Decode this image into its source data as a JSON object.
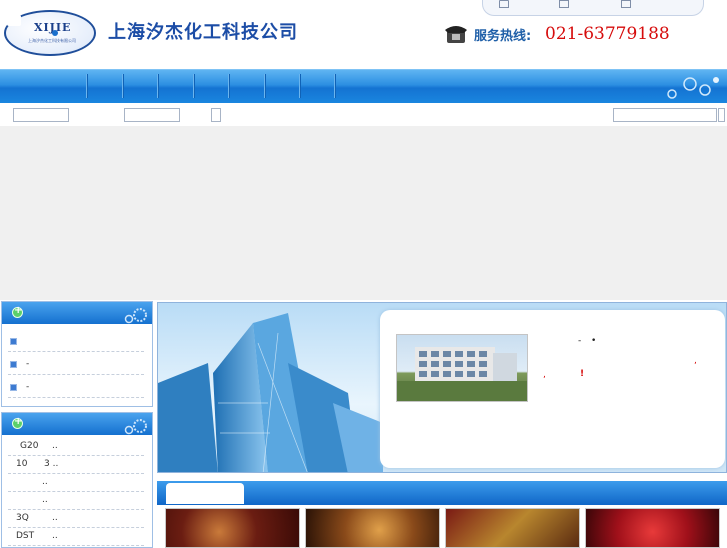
{
  "header": {
    "logo_text": "XIJIE",
    "logo_subtext": "上海汐杰化工科技有限公司",
    "company_name": "上海汐杰化工科技公司",
    "hotline_label": "服务热线:",
    "hotline_number": "021-63779188",
    "top_links": [
      "home-icon",
      "sitemap-icon",
      "mail-icon"
    ]
  },
  "sidebar": {
    "panel1": {
      "items": [
        {
          "label": ""
        },
        {
          "label": "-"
        },
        {
          "label": "-"
        }
      ]
    },
    "panel2": {
      "rows": [
        {
          "a": "G20",
          "b": ".."
        },
        {
          "a": "10",
          "b": "3 .."
        },
        {
          "a": "",
          "b": ".."
        },
        {
          "a": "",
          "b": ".."
        },
        {
          "a": "3Q",
          "b": ".."
        },
        {
          "a": "DST",
          "b": ".."
        }
      ]
    }
  },
  "banner": {
    "marks": [
      "-",
      "•",
      ",",
      ",",
      "!"
    ]
  },
  "colors": {
    "accent_blue": "#1473d2",
    "hotline_red": "#d60b0b",
    "title_blue": "#1c4da6"
  }
}
